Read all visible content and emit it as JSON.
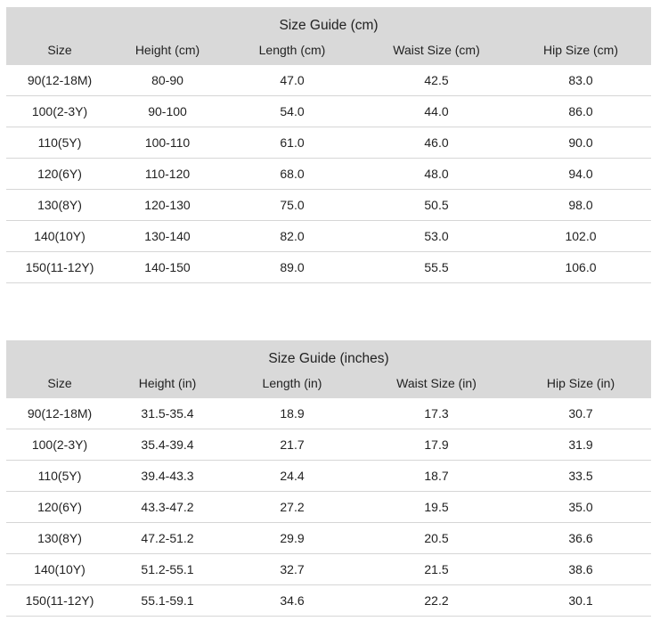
{
  "tables": [
    {
      "title": "Size Guide (cm)",
      "headers": [
        "Size",
        "Height (cm)",
        "Length (cm)",
        "Waist Size (cm)",
        "Hip Size (cm)"
      ],
      "rows": [
        [
          "90(12-18M)",
          "80-90",
          "47.0",
          "42.5",
          "83.0"
        ],
        [
          "100(2-3Y)",
          "90-100",
          "54.0",
          "44.0",
          "86.0"
        ],
        [
          "110(5Y)",
          "100-110",
          "61.0",
          "46.0",
          "90.0"
        ],
        [
          "120(6Y)",
          "110-120",
          "68.0",
          "48.0",
          "94.0"
        ],
        [
          "130(8Y)",
          "120-130",
          "75.0",
          "50.5",
          "98.0"
        ],
        [
          "140(10Y)",
          "130-140",
          "82.0",
          "53.0",
          "102.0"
        ],
        [
          "150(11-12Y)",
          "140-150",
          "89.0",
          "55.5",
          "106.0"
        ]
      ]
    },
    {
      "title": "Size Guide (inches)",
      "headers": [
        "Size",
        "Height (in)",
        "Length (in)",
        "Waist Size (in)",
        "Hip Size (in)"
      ],
      "rows": [
        [
          "90(12-18M)",
          "31.5-35.4",
          "18.9",
          "17.3",
          "30.7"
        ],
        [
          "100(2-3Y)",
          "35.4-39.4",
          "21.7",
          "17.9",
          "31.9"
        ],
        [
          "110(5Y)",
          "39.4-43.3",
          "24.4",
          "18.7",
          "33.5"
        ],
        [
          "120(6Y)",
          "43.3-47.2",
          "27.2",
          "19.5",
          "35.0"
        ],
        [
          "130(8Y)",
          "47.2-51.2",
          "29.9",
          "20.5",
          "36.6"
        ],
        [
          "140(10Y)",
          "51.2-55.1",
          "32.7",
          "21.5",
          "38.6"
        ],
        [
          "150(11-12Y)",
          "55.1-59.1",
          "34.6",
          "22.2",
          "30.1"
        ]
      ]
    }
  ],
  "colors": {
    "header_background": "#d9d9d9",
    "row_divider": "#d6d6d6",
    "text": "#222222"
  }
}
